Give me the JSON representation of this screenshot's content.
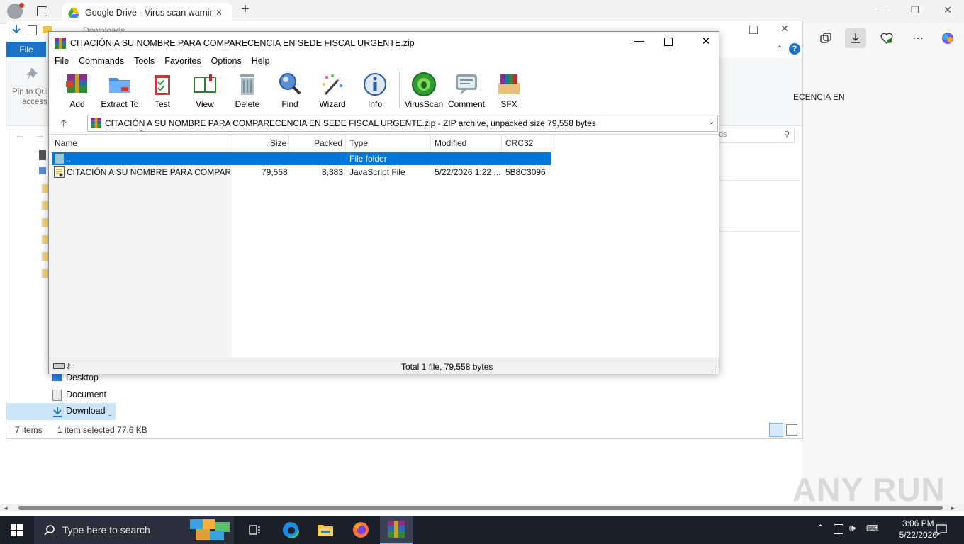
{
  "browser": {
    "tab_title": "Google Drive - Virus scan warning",
    "tab_close": "✕",
    "new_tab": "+",
    "controls": [
      "—",
      "❐",
      "✕"
    ]
  },
  "explorer": {
    "breadcrumb": "Downloads",
    "file_tab": "File",
    "pin_label_1": "Pin to Qui",
    "pin_label_2": "access",
    "truncated_text": "ECENCIA EN",
    "search_placeholder": "ds",
    "tree_items": [
      "Desktop",
      "Document",
      "Download"
    ],
    "status_items": "7 items",
    "status_selected": "1 item selected  77.6 KB"
  },
  "winrar": {
    "title": "CITACIÓN A SU NOMBRE PARA COMPARECENCIA EN SEDE FISCAL URGENTE.zip",
    "menu": [
      "File",
      "Commands",
      "Tools",
      "Favorites",
      "Options",
      "Help"
    ],
    "tools": [
      {
        "label": "Add",
        "icon": "add-icon"
      },
      {
        "label": "Extract To",
        "icon": "extract-folder-icon"
      },
      {
        "label": "Test",
        "icon": "test-clipboard-icon"
      },
      {
        "label": "View",
        "icon": "view-book-icon"
      },
      {
        "label": "Delete",
        "icon": "trash-icon"
      },
      {
        "label": "Find",
        "icon": "magnifier-icon"
      },
      {
        "label": "Wizard",
        "icon": "wand-icon"
      },
      {
        "label": "Info",
        "icon": "info-icon"
      },
      {
        "label": "VirusScan",
        "icon": "virus-scan-icon"
      },
      {
        "label": "Comment",
        "icon": "comment-icon"
      },
      {
        "label": "SFX",
        "icon": "sfx-icon"
      }
    ],
    "address": "CITACIÓN A SU NOMBRE PARA COMPARECENCIA EN SEDE FISCAL URGENTE.zip - ZIP archive, unpacked size 79,558 bytes",
    "columns": [
      "Name",
      "Size",
      "Packed",
      "Type",
      "Modified",
      "CRC32"
    ],
    "rows": [
      {
        "name": "..",
        "size": "",
        "packed": "",
        "type": "File folder",
        "modified": "",
        "crc": "",
        "selected": true
      },
      {
        "name": "CITACIÓN A SU NOMBRE PARA COMPARE...",
        "size": "79,558",
        "packed": "8,383",
        "type": "JavaScript File",
        "modified": "5/22/2026 1:22 ...",
        "crc": "5B8C3096",
        "selected": false
      }
    ],
    "status": "Total 1 file, 79,558 bytes"
  },
  "taskbar": {
    "search_placeholder": "Type here to search",
    "time": "3:06 PM",
    "date": "5/22/2026"
  },
  "watermark": "ANY RUN",
  "colors": {
    "selection": "#0078d7",
    "taskbar": "#1b1f2a",
    "file_tab": "#1a73c9"
  }
}
